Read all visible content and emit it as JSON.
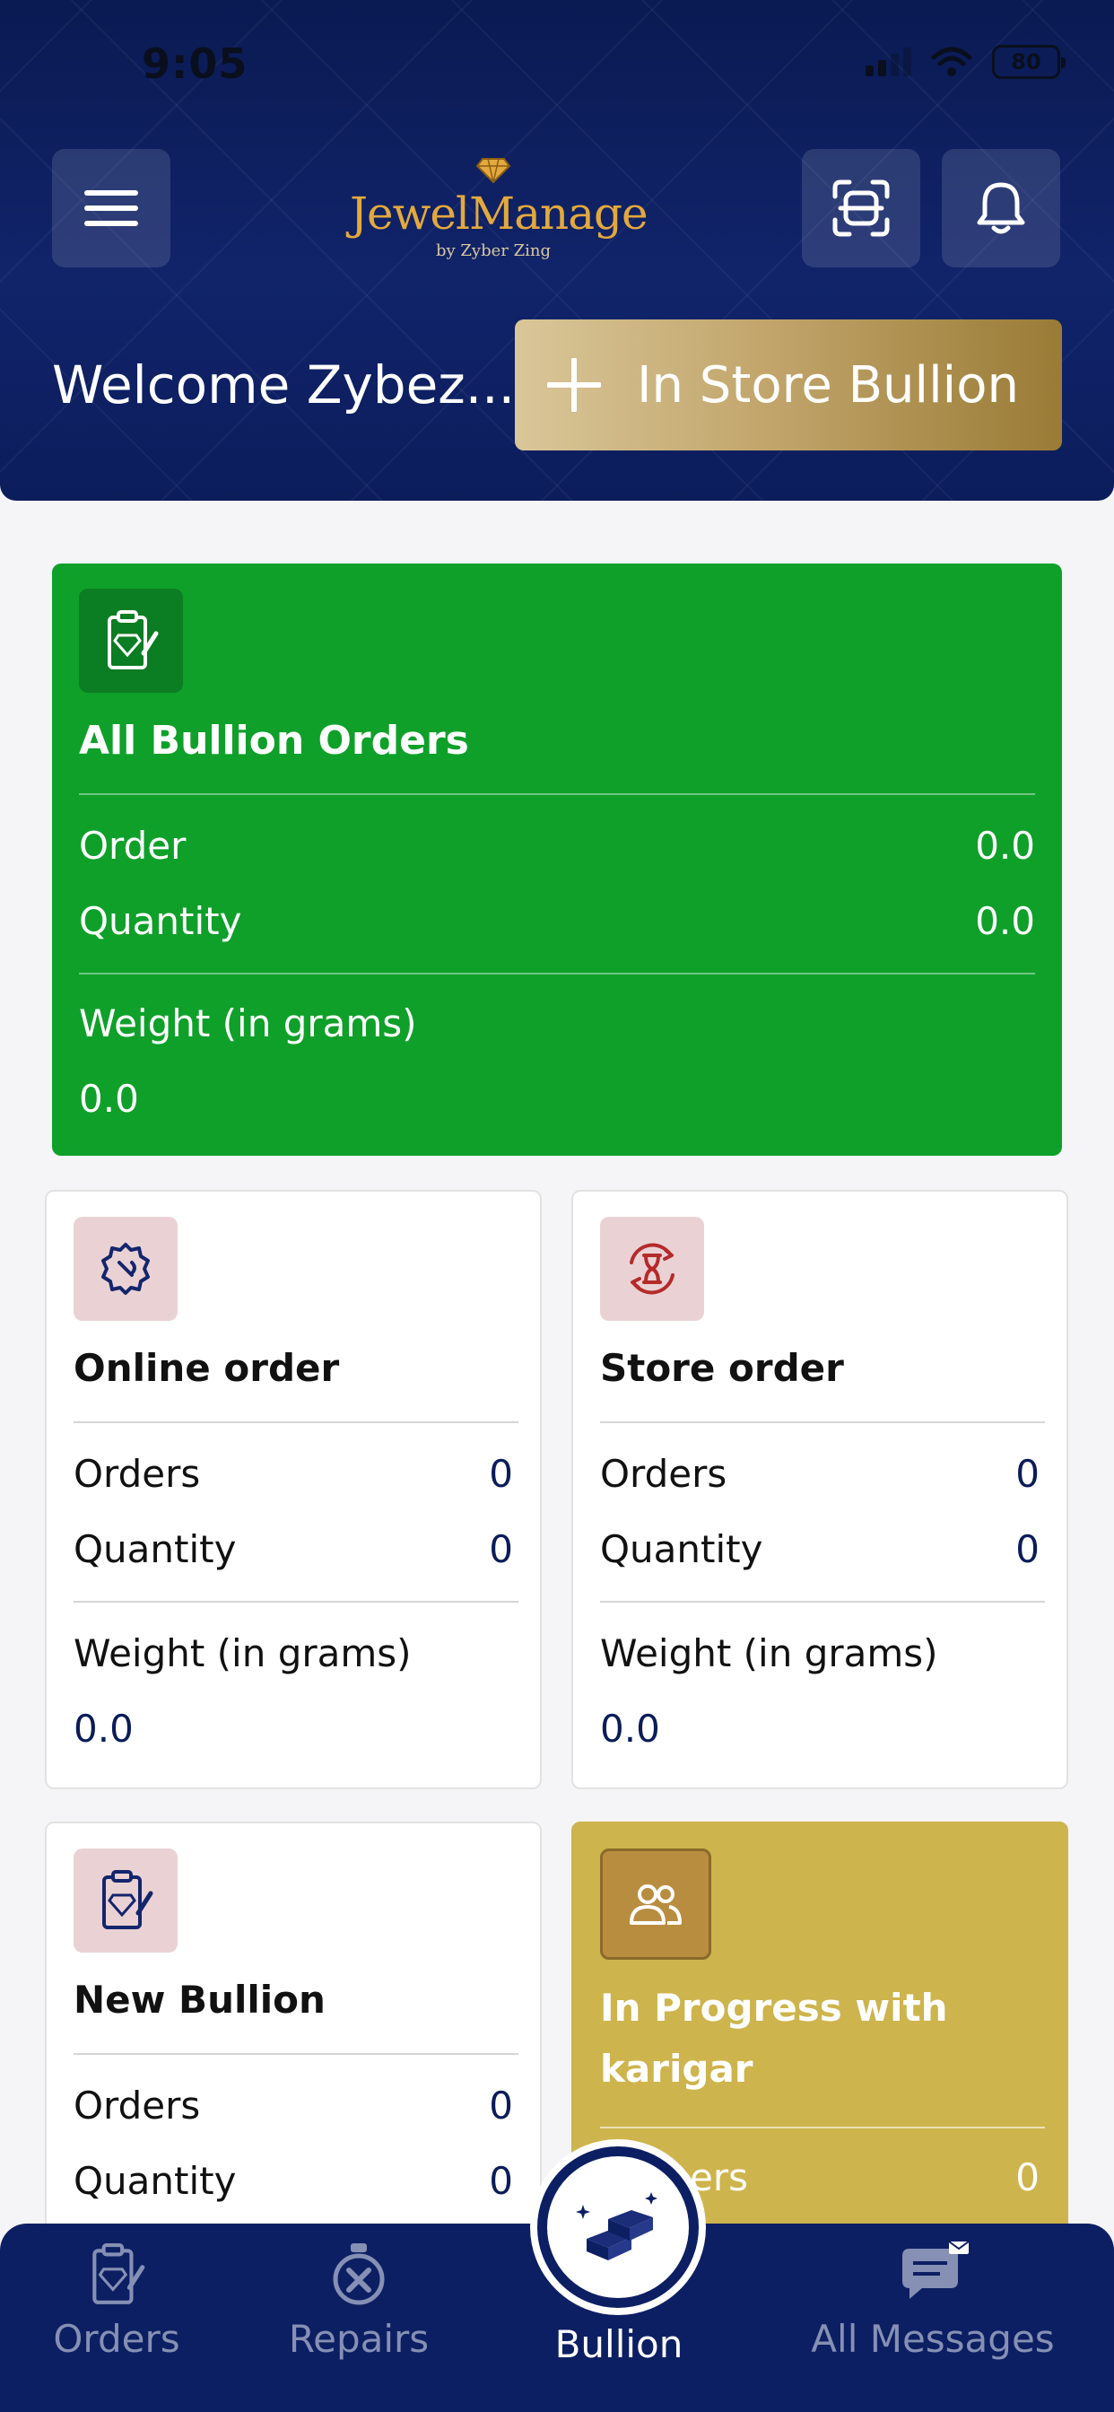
{
  "status_bar": {
    "time": "9:05",
    "battery": "80"
  },
  "header": {
    "logo_text": "JewelManage",
    "logo_subtitle": "by Zyber Zing",
    "welcome": "Welcome Zybez...",
    "store_bullion_button": "In Store Bullion"
  },
  "summary_card": {
    "title": "All Bullion Orders",
    "order_label": "Order",
    "order_value": "0.0",
    "quantity_label": "Quantity",
    "quantity_value": "0.0",
    "weight_label": "Weight (in grams)",
    "weight_value": "0.0",
    "color": "#0fa02a"
  },
  "online_card": {
    "title": "Online order",
    "orders_label": "Orders",
    "orders_value": "0",
    "quantity_label": "Quantity",
    "quantity_value": "0",
    "weight_label": "Weight (in grams)",
    "weight_value": "0.0"
  },
  "store_card": {
    "title": "Store order",
    "orders_label": "Orders",
    "orders_value": "0",
    "quantity_label": "Quantity",
    "quantity_value": "0",
    "weight_label": "Weight (in grams)",
    "weight_value": "0.0"
  },
  "new_card": {
    "title": "New Bullion",
    "orders_label": "Orders",
    "orders_value": "0",
    "quantity_label": "Quantity",
    "quantity_value": "0"
  },
  "progress_card": {
    "title_line1": "In Progress with",
    "title_line2": "karigar",
    "orders_label_partial": "ers",
    "orders_value": "0",
    "color": "#cdb44c"
  },
  "bottom_nav": {
    "orders": "Orders",
    "repairs": "Repairs",
    "bullion": "Bullion",
    "messages": "All Messages",
    "active": "Bullion"
  },
  "icons": [
    "menu-icon",
    "scan-icon",
    "bell-icon",
    "diamond-logo-icon",
    "plus-icon",
    "clipboard-diamond-icon",
    "gear-wrench-icon",
    "hourglass-sync-icon",
    "users-icon",
    "gold-bars-icon",
    "repair-tools-icon",
    "chat-icon"
  ]
}
